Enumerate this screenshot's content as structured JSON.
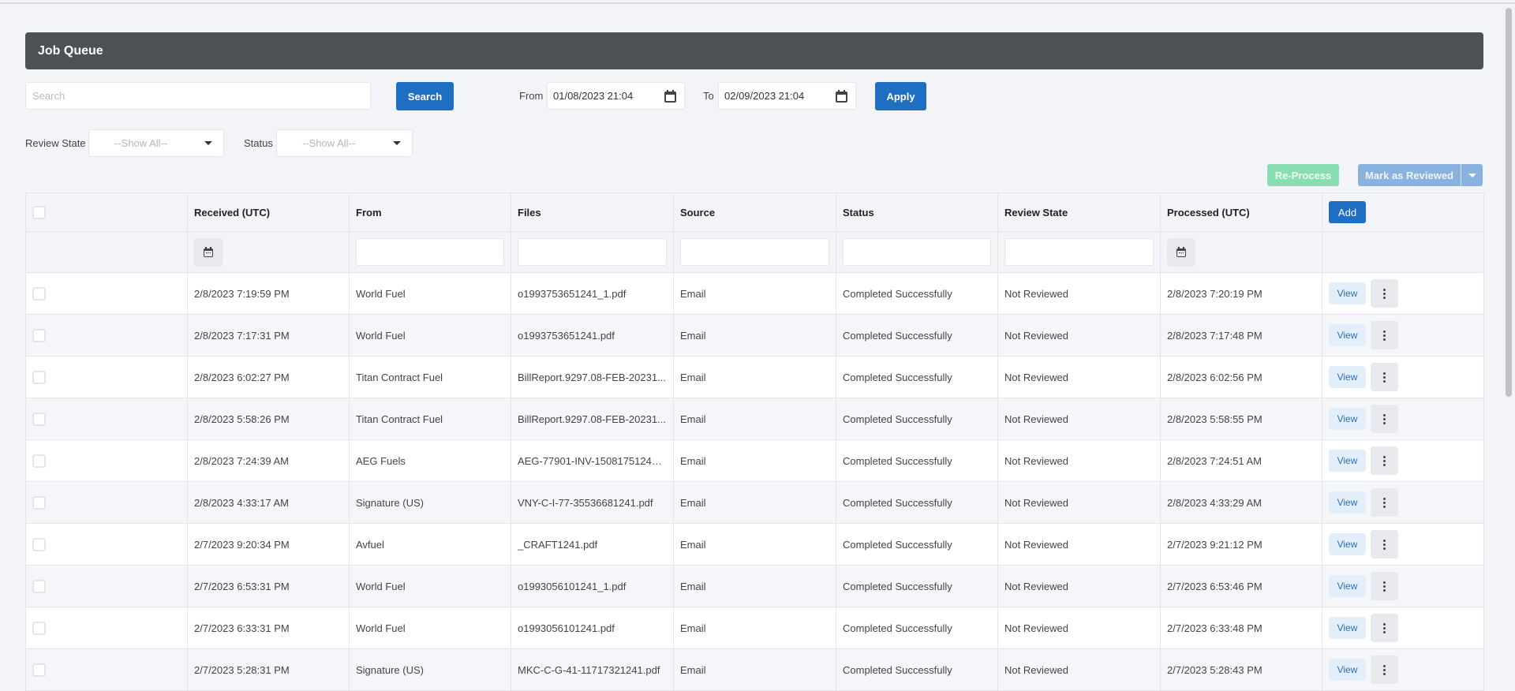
{
  "header": {
    "title": "Job Queue"
  },
  "search": {
    "placeholder": "Search",
    "value": "",
    "button_label": "Search"
  },
  "date_range": {
    "from_label": "From",
    "from_value": "01/08/2023 21:04",
    "to_label": "To",
    "to_value": "02/09/2023 21:04",
    "apply_label": "Apply"
  },
  "filters": {
    "review_state_label": "Review State",
    "review_state_value": "--Show All--",
    "status_label": "Status",
    "status_value": "--Show All--"
  },
  "actions": {
    "reprocess_label": "Re-Process",
    "mark_reviewed_label": "Mark as Reviewed",
    "add_label": "Add"
  },
  "colors": {
    "primary": "#1e6ec4",
    "header_bar": "#4d5055",
    "success_text": "#2d8a2d",
    "reprocess_disabled": "#88ddb2",
    "mark_reviewed_disabled": "#8ab2df"
  },
  "table": {
    "columns": [
      "",
      "Received (UTC)",
      "From",
      "Files",
      "Source",
      "Status",
      "Review State",
      "Processed (UTC)",
      ""
    ],
    "row_action_label": "View",
    "rows": [
      {
        "received": "2/8/2023 7:19:59 PM",
        "from": "World Fuel",
        "files": "o1993753651241_1.pdf",
        "source": "Email",
        "status": "Completed Successfully",
        "review_state": "Not Reviewed",
        "processed": "2/8/2023 7:20:19 PM"
      },
      {
        "received": "2/8/2023 7:17:31 PM",
        "from": "World Fuel",
        "files": "o1993753651241.pdf",
        "source": "Email",
        "status": "Completed Successfully",
        "review_state": "Not Reviewed",
        "processed": "2/8/2023 7:17:48 PM"
      },
      {
        "received": "2/8/2023 6:02:27 PM",
        "from": "Titan Contract Fuel",
        "files": "BillReport.9297.08-FEB-20231...",
        "source": "Email",
        "status": "Completed Successfully",
        "review_state": "Not Reviewed",
        "processed": "2/8/2023 6:02:56 PM"
      },
      {
        "received": "2/8/2023 5:58:26 PM",
        "from": "Titan Contract Fuel",
        "files": "BillReport.9297.08-FEB-20231...",
        "source": "Email",
        "status": "Completed Successfully",
        "review_state": "Not Reviewed",
        "processed": "2/8/2023 5:58:55 PM"
      },
      {
        "received": "2/8/2023 7:24:39 AM",
        "from": "AEG Fuels",
        "files": "AEG-77901-INV-15081751241....",
        "source": "Email",
        "status": "Completed Successfully",
        "review_state": "Not Reviewed",
        "processed": "2/8/2023 7:24:51 AM"
      },
      {
        "received": "2/8/2023 4:33:17 AM",
        "from": "Signature (US)",
        "files": "VNY-C-I-77-35536681241.pdf",
        "source": "Email",
        "status": "Completed Successfully",
        "review_state": "Not Reviewed",
        "processed": "2/8/2023 4:33:29 AM"
      },
      {
        "received": "2/7/2023 9:20:34 PM",
        "from": "Avfuel",
        "files": "_CRAFT1241.pdf",
        "source": "Email",
        "status": "Completed Successfully",
        "review_state": "Not Reviewed",
        "processed": "2/7/2023 9:21:12 PM"
      },
      {
        "received": "2/7/2023 6:53:31 PM",
        "from": "World Fuel",
        "files": "o1993056101241_1.pdf",
        "source": "Email",
        "status": "Completed Successfully",
        "review_state": "Not Reviewed",
        "processed": "2/7/2023 6:53:46 PM"
      },
      {
        "received": "2/7/2023 6:33:31 PM",
        "from": "World Fuel",
        "files": "o1993056101241.pdf",
        "source": "Email",
        "status": "Completed Successfully",
        "review_state": "Not Reviewed",
        "processed": "2/7/2023 6:33:48 PM"
      },
      {
        "received": "2/7/2023 5:28:31 PM",
        "from": "Signature (US)",
        "files": "MKC-C-G-41-11717321241.pdf",
        "source": "Email",
        "status": "Completed Successfully",
        "review_state": "Not Reviewed",
        "processed": "2/7/2023 5:28:43 PM"
      }
    ]
  }
}
